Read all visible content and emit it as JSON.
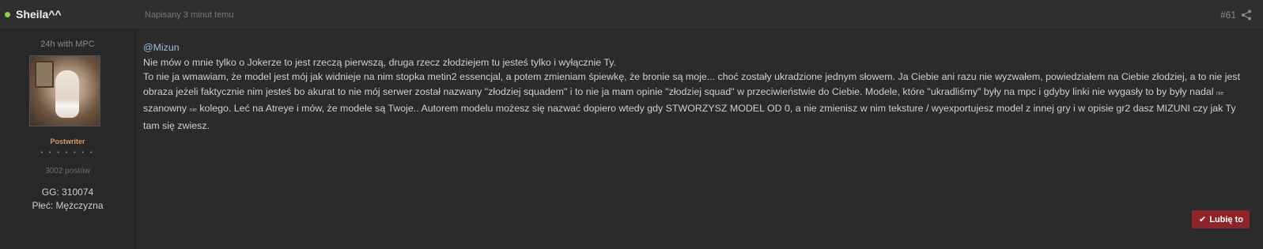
{
  "header": {
    "username": "Sheila^^",
    "posted": "Napisany 3 minut temu",
    "post_number": "#61"
  },
  "author": {
    "title": "24h with MPC",
    "group": "Postwriter",
    "rank_pips": "• • • • • • •",
    "post_count": "3002 postów",
    "gg": "GG: 310074",
    "sex": "Płeć: Mężczyzna"
  },
  "body": {
    "mention": "@Mizun",
    "line1": "Nie mów o mnie tylko o Jokerze to jest rzeczą pierwszą, druga rzecz złodziejem tu jesteś tylko i wyłącznie Ty.",
    "p2_a": "To nie ja wmawiam, że model jest mój jak widnieje na nim stopka metin2 essencjal, a potem zmieniam śpiewkę, że bronie są moje... choć zostały ukradzione jednym słowem. Ja Ciebie ani razu nie wyzwałem, powiedziałem na Ciebie złodziej, a to nie jest obraza jeżeli faktycznie nim jesteś bo akurat to nie mój serwer został nazwany \"złodziej squadem\" i to nie ja mam opinie \"złodziej squad\" w przeciwieństwie do Ciebie. Modele, które \"ukradliśmy\" były na mpc i gdyby linki nie wygasły to by były nadal",
    "small1": "nie",
    "p2_b": "szanowny",
    "small2": "nie",
    "p2_c": "kolego. Leć na Atreye i mów, że modele są Twoje.. Autorem modelu możesz się nazwać dopiero wtedy gdy STWORZYSZ MODEL OD 0, a nie zmienisz w nim teksture / wyexportujesz model z innej gry i w opisie gr2 dasz MIZUNI czy jak Ty tam się zwiesz."
  },
  "like_button": {
    "icon": "check-icon",
    "label": "Lubię to"
  },
  "colors": {
    "online": "#8fd14f",
    "like_button": "#8e2529",
    "group": "#d89a6a",
    "mention": "#9cc0d6"
  }
}
